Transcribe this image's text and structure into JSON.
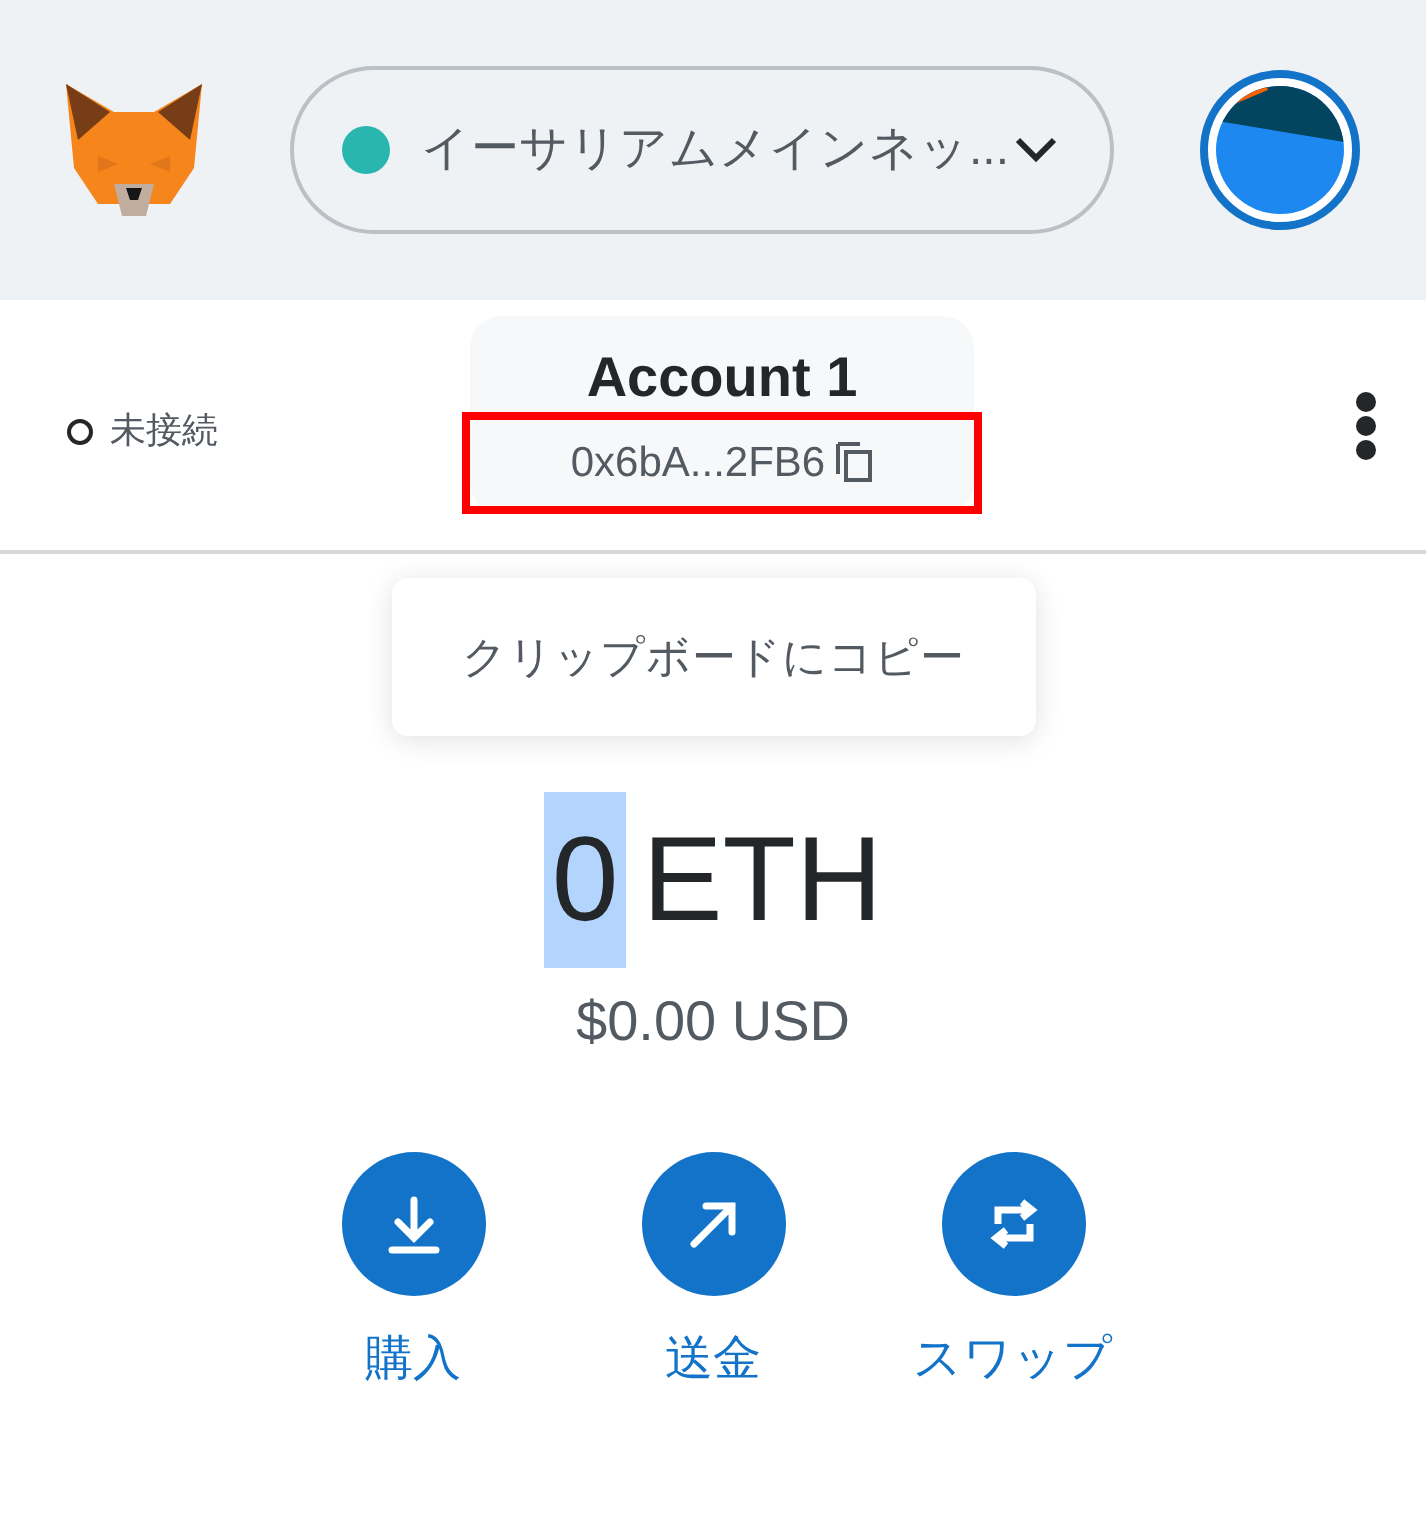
{
  "network": {
    "label": "イーサリアムメインネッ...",
    "color": "#29b6af"
  },
  "account": {
    "status": "未接続",
    "connected": false,
    "name": "Account 1",
    "address": "0x6bA...2FB6",
    "highlighted": true
  },
  "tooltip": "クリップボードにコピー",
  "balance": {
    "amount": "0",
    "amount_selected": true,
    "unit": "ETH",
    "fiat": "$0.00 USD"
  },
  "actions": [
    {
      "label": "購入",
      "kind": "buy"
    },
    {
      "label": "送金",
      "kind": "send"
    },
    {
      "label": "スワップ",
      "kind": "swap"
    }
  ]
}
